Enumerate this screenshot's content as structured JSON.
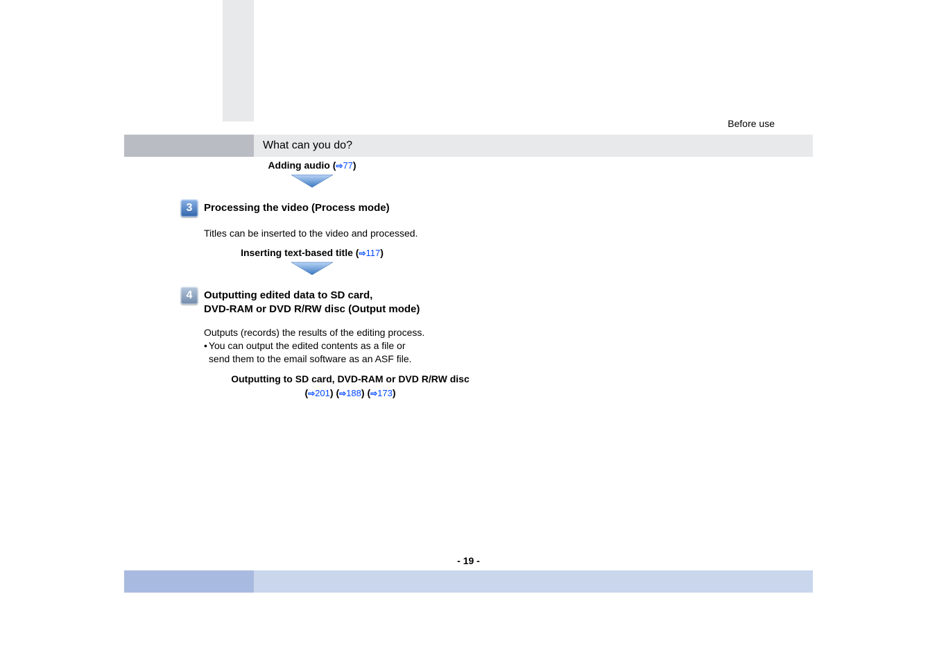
{
  "header_label": "Before use",
  "title": "What can you do?",
  "adding_audio_label": "Adding audio (",
  "adding_audio_page": "77",
  "close_paren": ")",
  "step3": {
    "num": "3",
    "title": "Processing the video (Process mode)",
    "body": "Titles can be inserted to the video and processed."
  },
  "inserting_title_label": "Inserting text-based title (",
  "inserting_title_page": "117",
  "step4": {
    "num": "4",
    "title_line1": "Outputting edited data to SD card,",
    "title_line2": "DVD-RAM or DVD R/RW disc (Output mode)",
    "body_line1": "Outputs (records) the results of the editing process.",
    "bullet_line1": "You can output the edited contents as a file or",
    "bullet_line2": "send them to the email software as an ASF file."
  },
  "output_links_label": "Outputting to SD card, DVD-RAM or DVD R/RW disc",
  "p201": "201",
  "p188": "188",
  "p173": "173",
  "open_paren": "(",
  "close_paren_sp": ") ",
  "page_number": "- 19 -"
}
